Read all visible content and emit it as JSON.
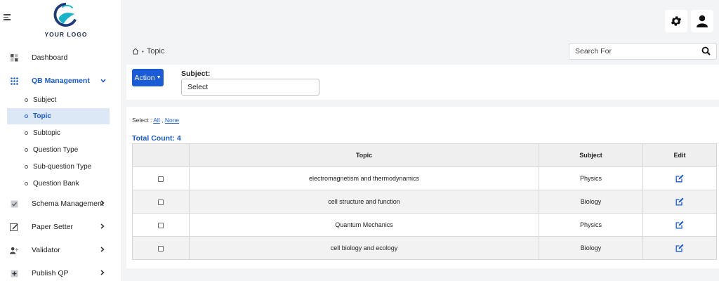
{
  "logo": {
    "text": "YOUR LOGO"
  },
  "sidebar": {
    "items": [
      {
        "label": "Dashboard",
        "icon": "dashboard-icon"
      },
      {
        "label": "QB Management",
        "icon": "grid-icon",
        "expanded": true
      },
      {
        "label": "Schema Management",
        "icon": "checkbox-icon"
      },
      {
        "label": "Paper Setter",
        "icon": "pencil-icon"
      },
      {
        "label": "Validator",
        "icon": "user-add-icon"
      },
      {
        "label": "Publish QP",
        "icon": "publish-icon"
      }
    ],
    "sub_items": [
      {
        "label": "Subject"
      },
      {
        "label": "Topic",
        "selected": true
      },
      {
        "label": "Subtopic"
      },
      {
        "label": "Question Type"
      },
      {
        "label": "Sub-question Type"
      },
      {
        "label": "Question Bank"
      }
    ]
  },
  "breadcrumb": {
    "current": "Topic"
  },
  "search": {
    "placeholder": "Search For"
  },
  "filter": {
    "action_label": "Action",
    "subject_label": "Subject:",
    "subject_value": "Select"
  },
  "selection": {
    "prefix": "Select :",
    "all": "All",
    "separator": ",",
    "none": "None"
  },
  "total_count": "Total Count: 4",
  "table": {
    "columns": [
      "Topic",
      "Subject",
      "Edit"
    ],
    "rows": [
      {
        "topic": "electromagnetism and thermodynamics",
        "subject": "Physics"
      },
      {
        "topic": "cell structure and function",
        "subject": "Biology"
      },
      {
        "topic": "Quantum Mechanics",
        "subject": "Physics"
      },
      {
        "topic": "cell biology and ecology",
        "subject": "Biology"
      }
    ]
  },
  "colors": {
    "accent": "#1a5bd6",
    "selected_bg": "#dde8f7"
  }
}
